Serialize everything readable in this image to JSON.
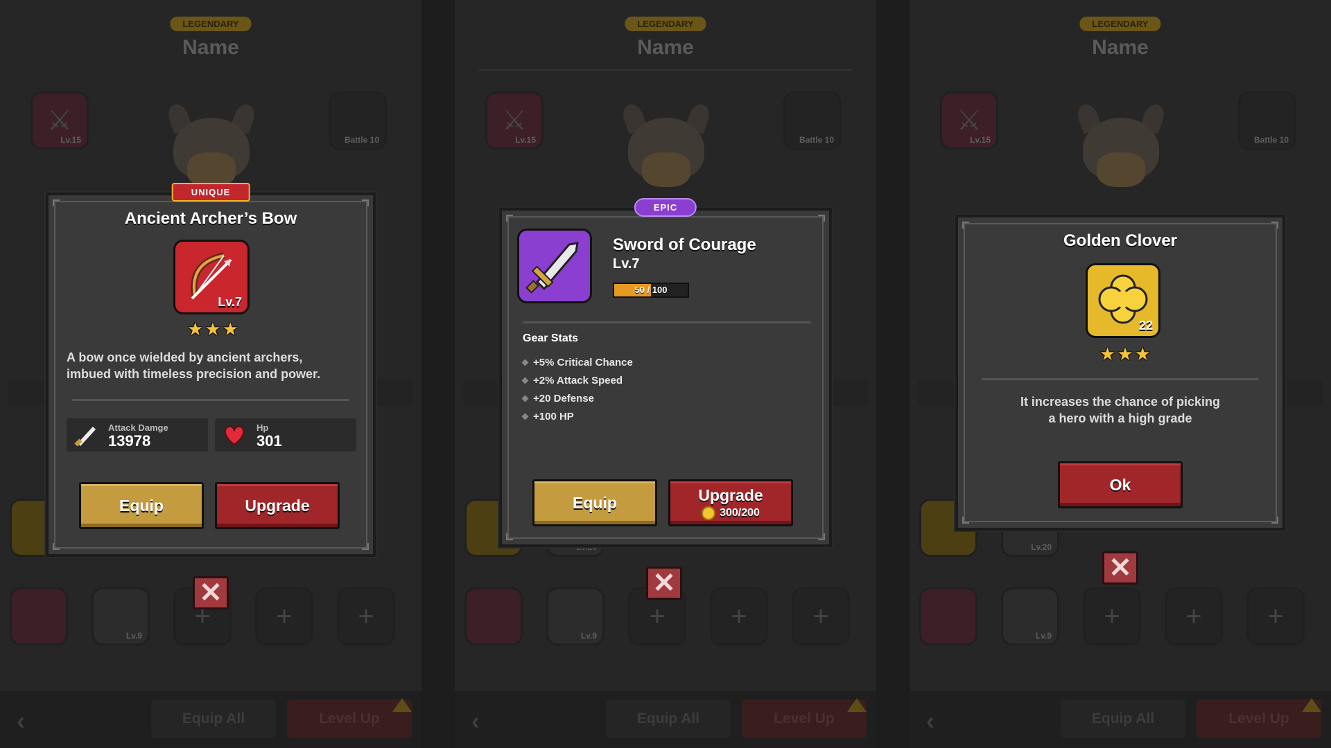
{
  "background": {
    "rarity_label": "LEGENDARY",
    "hero_name": "Name",
    "equip_all_label": "Equip All",
    "level_up_label": "Level Up",
    "slot_levels": [
      "Lv.15",
      "Lv.20",
      "Lv.9"
    ],
    "locked_slot_label": "Battle 10"
  },
  "dialog_bow": {
    "rarity_badge": "UNIQUE",
    "title": "Ancient Archer’s Bow",
    "level": "Lv.7",
    "stars": 3,
    "description_line1": "A bow once wielded by ancient archers,",
    "description_line2": "imbued with timeless precision and power.",
    "stat1_label": "Attack Damge",
    "stat1_value": "13978",
    "stat2_label": "Hp",
    "stat2_value": "301",
    "equip_label": "Equip",
    "upgrade_label": "Upgrade"
  },
  "dialog_sword": {
    "rarity_badge": "EPIC",
    "title": "Sword of Courage",
    "level": "Lv.7",
    "xp_text": "50 / 100",
    "xp_current": 50,
    "xp_max": 100,
    "gear_stats_title": "Gear Stats",
    "gear_stats": [
      "+5% Critical Chance",
      "+2% Attack Speed",
      "+20 Defense",
      "+100 HP"
    ],
    "equip_label": "Equip",
    "upgrade_label": "Upgrade",
    "upgrade_cost": "300/200"
  },
  "dialog_clover": {
    "title": "Golden Clover",
    "count": "22",
    "stars": 3,
    "description_line1": "It increases the chance of picking",
    "description_line2": "a hero with a high grade",
    "ok_label": "Ok"
  },
  "colors": {
    "unique_red": "#c1272d",
    "epic_purple": "#8a3fd1",
    "gold_button": "#c59b3f",
    "red_button": "#a1262a",
    "star_yellow": "#f6c23c"
  },
  "icons": [
    "close-icon",
    "bow-icon",
    "sword-icon",
    "clover-icon",
    "heart-icon",
    "coin-icon",
    "back-arrow-icon"
  ]
}
